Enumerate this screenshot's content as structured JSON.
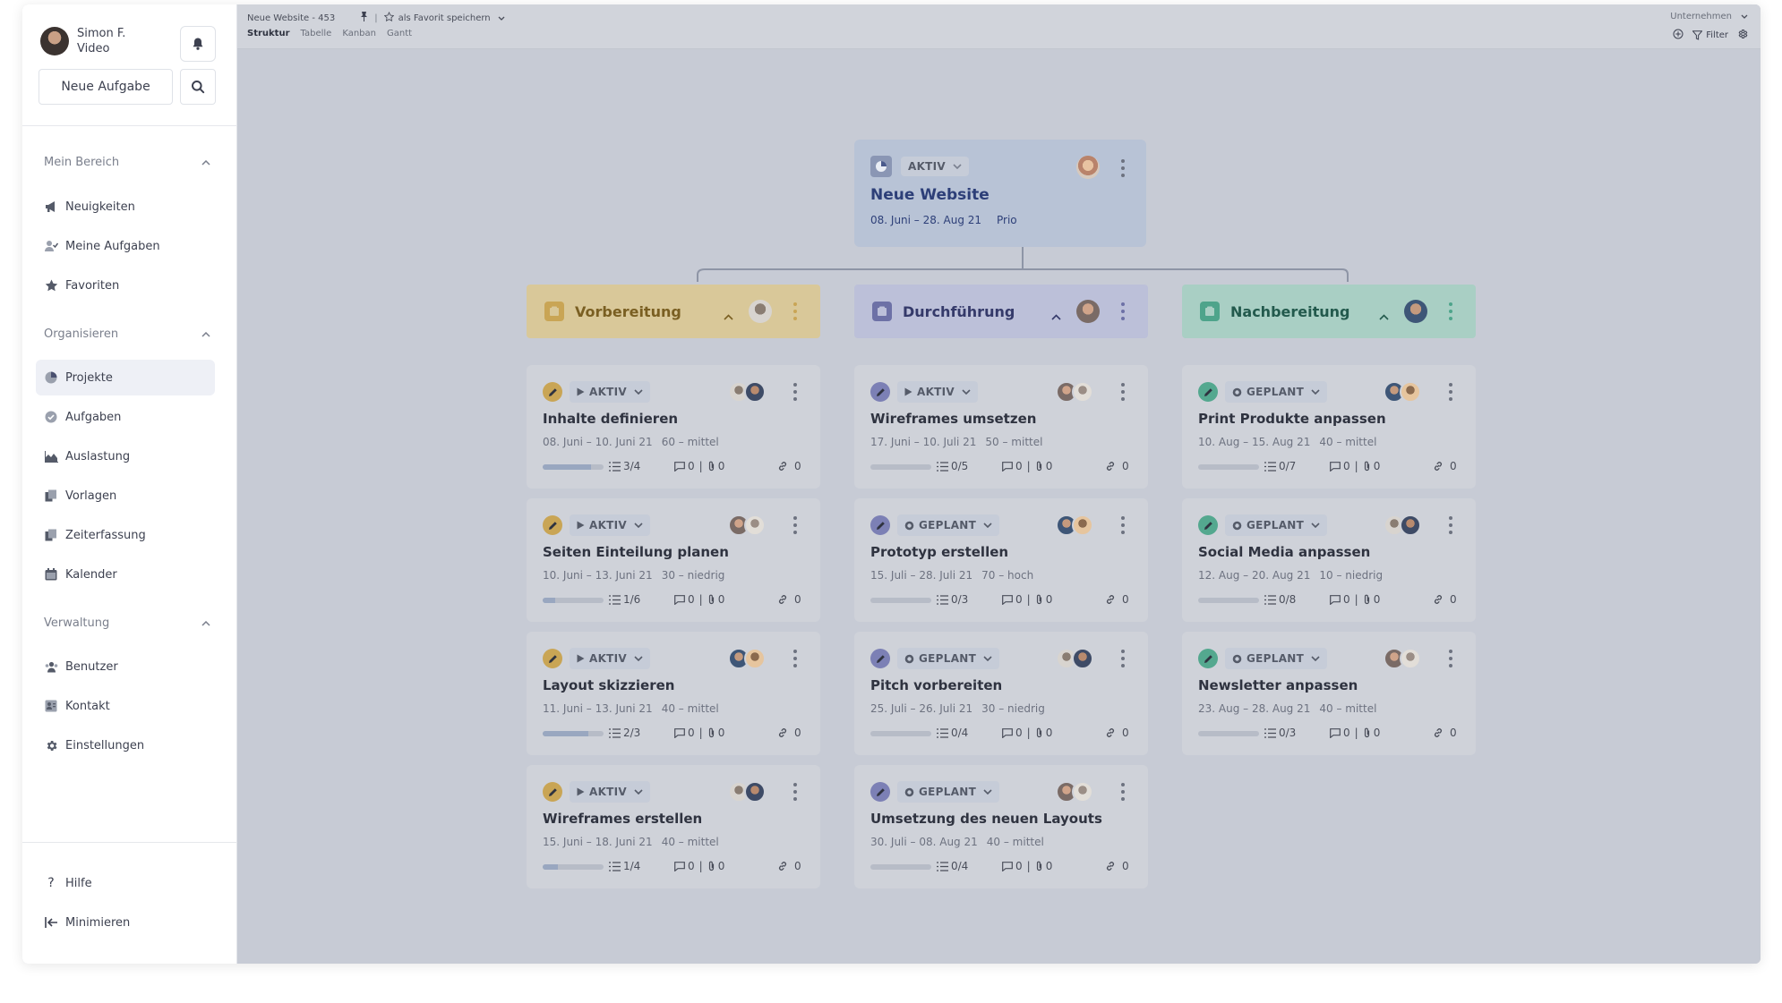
{
  "user": {
    "name": "Simon F.",
    "role": "Video"
  },
  "sidebar": {
    "new_task_label": "Neue Aufgabe",
    "sections": [
      {
        "label": "Mein Bereich",
        "items": [
          {
            "label": "Neuigkeiten",
            "icon": "megaphone-icon"
          },
          {
            "label": "Meine Aufgaben",
            "icon": "user-check-icon"
          },
          {
            "label": "Favoriten",
            "icon": "star-icon"
          }
        ]
      },
      {
        "label": "Organisieren",
        "items": [
          {
            "label": "Projekte",
            "icon": "pie-chart-icon"
          },
          {
            "label": "Aufgaben",
            "icon": "check-circle-icon"
          },
          {
            "label": "Auslastung",
            "icon": "area-chart-icon"
          },
          {
            "label": "Vorlagen",
            "icon": "template-icon"
          },
          {
            "label": "Zeiterfassung",
            "icon": "timesheet-icon"
          },
          {
            "label": "Kalender",
            "icon": "calendar-icon"
          }
        ]
      },
      {
        "label": "Verwaltung",
        "items": [
          {
            "label": "Benutzer",
            "icon": "users-icon"
          },
          {
            "label": "Kontakt",
            "icon": "contact-card-icon"
          },
          {
            "label": "Einstellungen",
            "icon": "gear-icon"
          }
        ]
      }
    ],
    "footer": [
      {
        "label": "Hilfe",
        "icon": "question-icon"
      },
      {
        "label": "Minimieren",
        "icon": "collapse-left-icon"
      }
    ]
  },
  "topbar": {
    "breadcrumb": "Neue Website - 453",
    "favorite_label": "als Favorit speichern",
    "tabs": [
      "Struktur",
      "Tabelle",
      "Kanban",
      "Gantt"
    ],
    "active_tab": "Struktur",
    "company": "Unternehmen",
    "filter_label": "Filter"
  },
  "project": {
    "status": "AKTIV",
    "title": "Neue Website",
    "dates": "08. Juni – 28. Aug 21",
    "priority": "Prio"
  },
  "columns": [
    {
      "title": "Vorbereitung",
      "head_bg": "#d9c899",
      "head_fg": "#7a5f22",
      "icon_bg": "#c9a555",
      "accent": "#c9a555",
      "tasks": [
        {
          "status": "AKTIV",
          "title": "Inhalte definieren",
          "dates": "08. Juni – 10. Juni 21",
          "effort": "60 – mittel",
          "subtasks": "3/4",
          "progress": 0.8,
          "comments": "0",
          "attachments": "0",
          "links": "0"
        },
        {
          "status": "AKTIV",
          "title": "Seiten Einteilung planen",
          "dates": "10. Juni – 13. Juni 21",
          "effort": "30 – niedrig",
          "subtasks": "1/6",
          "progress": 0.2,
          "comments": "0",
          "attachments": "0",
          "links": "0"
        },
        {
          "status": "AKTIV",
          "title": "Layout skizzieren",
          "dates": "11. Juni – 13. Juni 21",
          "effort": "40 – mittel",
          "subtasks": "2/3",
          "progress": 0.75,
          "comments": "0",
          "attachments": "0",
          "links": "0"
        },
        {
          "status": "AKTIV",
          "title": "Wireframes erstellen",
          "dates": "15. Juni – 18. Juni 21",
          "effort": "40 – mittel",
          "subtasks": "1/4",
          "progress": 0.25,
          "comments": "0",
          "attachments": "0",
          "links": "0"
        }
      ]
    },
    {
      "title": "Durchführung",
      "head_bg": "#bcc0d9",
      "head_fg": "#353a6a",
      "icon_bg": "#6d71a6",
      "accent": "#7c80b5",
      "tasks": [
        {
          "status": "AKTIV",
          "title": "Wireframes umsetzen",
          "dates": "17. Juni – 10. Juli 21",
          "effort": "50 – mittel",
          "subtasks": "0/5",
          "progress": 0,
          "comments": "0",
          "attachments": "0",
          "links": "0"
        },
        {
          "status": "GEPLANT",
          "title": "Prototyp erstellen",
          "dates": "15. Juli – 28. Juli 21",
          "effort": "70 – hoch",
          "subtasks": "0/3",
          "progress": 0,
          "comments": "0",
          "attachments": "0",
          "links": "0"
        },
        {
          "status": "GEPLANT",
          "title": "Pitch vorbereiten",
          "dates": "25. Juli – 26. Juli 21",
          "effort": "30 – niedrig",
          "subtasks": "0/4",
          "progress": 0,
          "comments": "0",
          "attachments": "0",
          "links": "0"
        },
        {
          "status": "GEPLANT",
          "title": "Umsetzung des neuen Layouts",
          "dates": "30. Juli – 08. Aug 21",
          "effort": "40 – mittel",
          "subtasks": "0/4",
          "progress": 0,
          "comments": "0",
          "attachments": "0",
          "links": "0"
        }
      ]
    },
    {
      "title": "Nachbereitung",
      "head_bg": "#a9cfc4",
      "head_fg": "#235a4d",
      "icon_bg": "#4ea48b",
      "accent": "#54a88f",
      "tasks": [
        {
          "status": "GEPLANT",
          "title": "Print Produkte anpassen",
          "dates": "10. Aug – 15. Aug 21",
          "effort": "40 – mittel",
          "subtasks": "0/7",
          "progress": 0,
          "comments": "0",
          "attachments": "0",
          "links": "0"
        },
        {
          "status": "GEPLANT",
          "title": "Social Media anpassen",
          "dates": "12. Aug – 20. Aug 21",
          "effort": "10 – niedrig",
          "subtasks": "0/8",
          "progress": 0,
          "comments": "0",
          "attachments": "0",
          "links": "0"
        },
        {
          "status": "GEPLANT",
          "title": "Newsletter anpassen",
          "dates": "23. Aug – 28. Aug 21",
          "effort": "40 – mittel",
          "subtasks": "0/3",
          "progress": 0,
          "comments": "0",
          "attachments": "0",
          "links": "0"
        }
      ]
    }
  ]
}
